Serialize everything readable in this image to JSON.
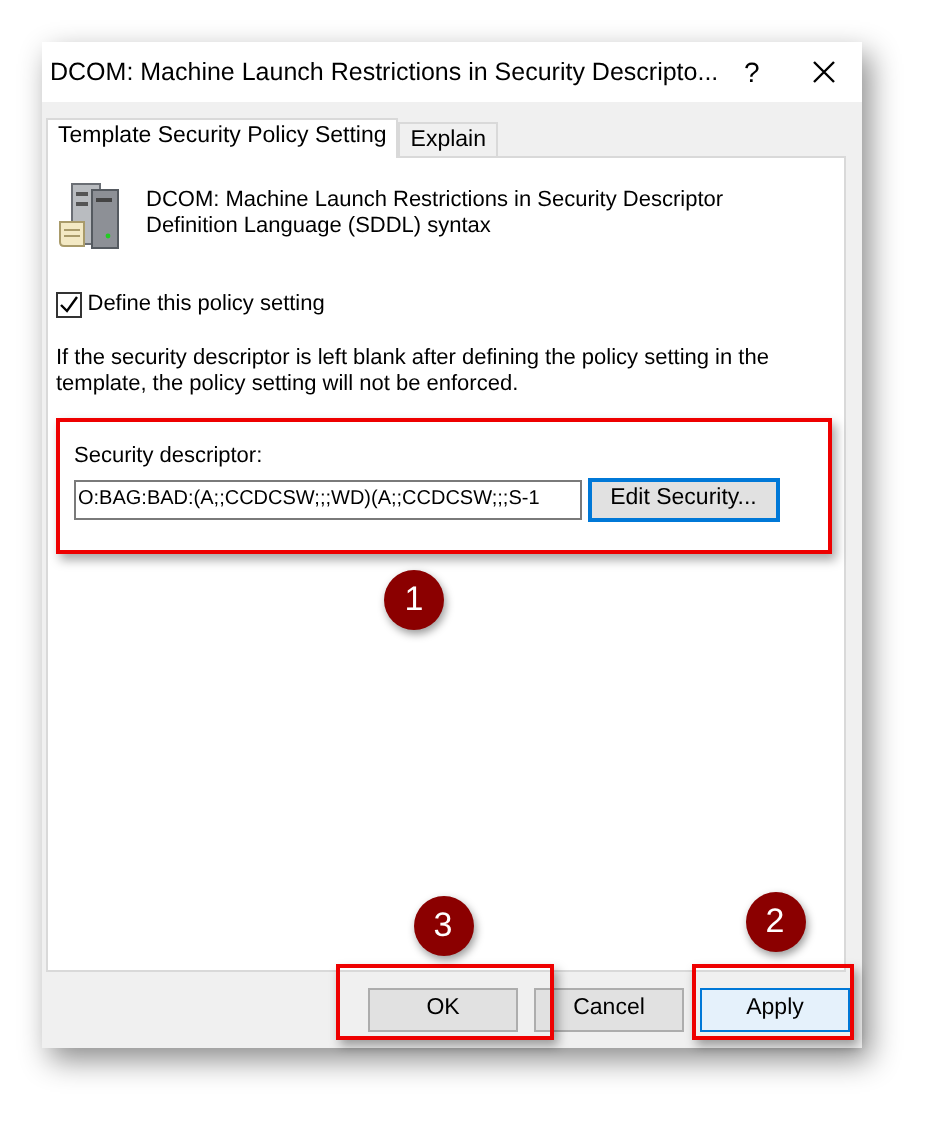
{
  "window": {
    "title": "DCOM: Machine Launch Restrictions in Security Descripto...",
    "help": "?"
  },
  "tabs": [
    {
      "label": "Template Security Policy Setting",
      "selected": true
    },
    {
      "label": "Explain",
      "selected": false
    }
  ],
  "policy": {
    "title": "DCOM: Machine Launch Restrictions in Security Descriptor Definition Language (SDDL) syntax"
  },
  "define_setting": {
    "label": "Define this policy setting",
    "checked": true
  },
  "note": "If the security descriptor is left blank after defining the policy setting in the template, the policy setting will not be enforced.",
  "security_descriptor": {
    "label": "Security descriptor:",
    "value": "O:BAG:BAD:(A;;CCDCSW;;;WD)(A;;CCDCSW;;;S-1",
    "button": "Edit Security...",
    "highlighted": true
  },
  "buttons": [
    {
      "label": "OK",
      "focused": false,
      "highlighted": true
    },
    {
      "label": "Cancel",
      "focused": false,
      "highlighted": false
    },
    {
      "label": "Apply",
      "focused": true,
      "highlighted": true
    }
  ],
  "callouts": [
    {
      "number": "1"
    },
    {
      "number": "2"
    },
    {
      "number": "3"
    }
  ]
}
